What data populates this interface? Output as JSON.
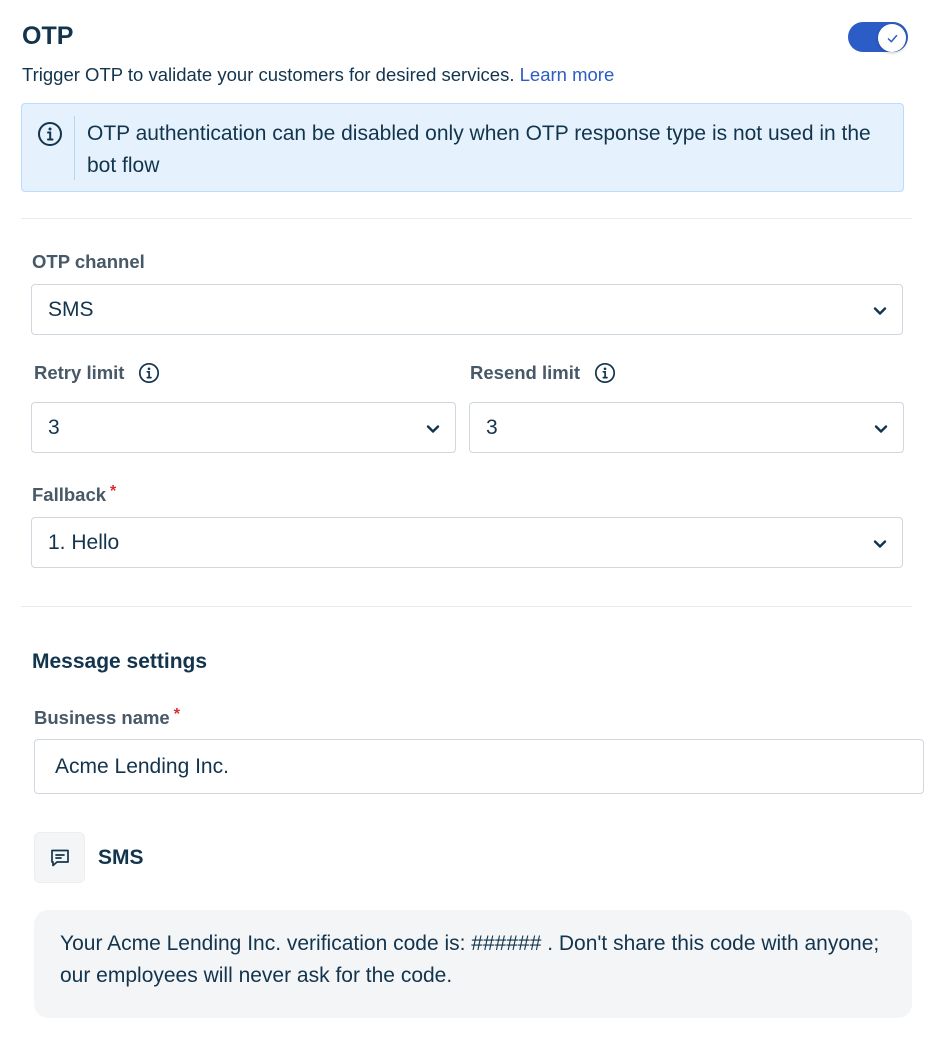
{
  "header": {
    "title": "OTP",
    "toggle_on": true,
    "description": "Trigger OTP to validate your customers for desired services.",
    "learn_more": "Learn more"
  },
  "info_banner": {
    "text": "OTP authentication can be disabled only when OTP response type is not used in the bot flow"
  },
  "otp_channel": {
    "label": "OTP channel",
    "value": "SMS"
  },
  "retry_limit": {
    "label": "Retry limit",
    "value": "3"
  },
  "resend_limit": {
    "label": "Resend limit",
    "value": "3"
  },
  "fallback": {
    "label": "Fallback",
    "required_mark": "*",
    "value": "1. Hello"
  },
  "message_settings": {
    "title": "Message settings",
    "business_name": {
      "label": "Business name",
      "required_mark": "*",
      "value": "Acme Lending Inc."
    },
    "sms": {
      "label": "SMS",
      "message": "Your Acme Lending Inc. verification code is: ###### . Don't share this code with anyone; our employees will never ask for the code."
    }
  },
  "colors": {
    "accent": "#2c5cc5",
    "text": "#12344d",
    "label": "#475867",
    "required": "#d72d30",
    "info_bg": "#e5f2fd"
  },
  "icons": {
    "info": "info-icon",
    "chevron": "chevron-down-icon",
    "check": "check-icon",
    "sms": "message-icon"
  }
}
